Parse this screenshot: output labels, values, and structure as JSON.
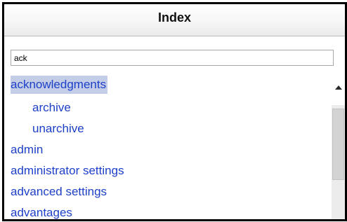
{
  "panel": {
    "title": "Index"
  },
  "search": {
    "value": "ack",
    "placeholder": ""
  },
  "index": {
    "selected": "acknowledgments",
    "items": [
      {
        "label": "acknowledgments",
        "level": 0,
        "selected": true
      },
      {
        "label": "archive",
        "level": 1,
        "selected": false
      },
      {
        "label": "unarchive",
        "level": 1,
        "selected": false
      },
      {
        "label": "admin",
        "level": 0,
        "selected": false
      },
      {
        "label": "administrator settings",
        "level": 0,
        "selected": false
      },
      {
        "label": "advanced settings",
        "level": 0,
        "selected": false
      },
      {
        "label": "advantages",
        "level": 0,
        "selected": false
      }
    ]
  },
  "scrollbar": {
    "up_arrow_icon": "triangle-up-icon"
  },
  "colors": {
    "link": "#1e40c8",
    "selection_background": "#c3cde8",
    "border": "#000000"
  }
}
